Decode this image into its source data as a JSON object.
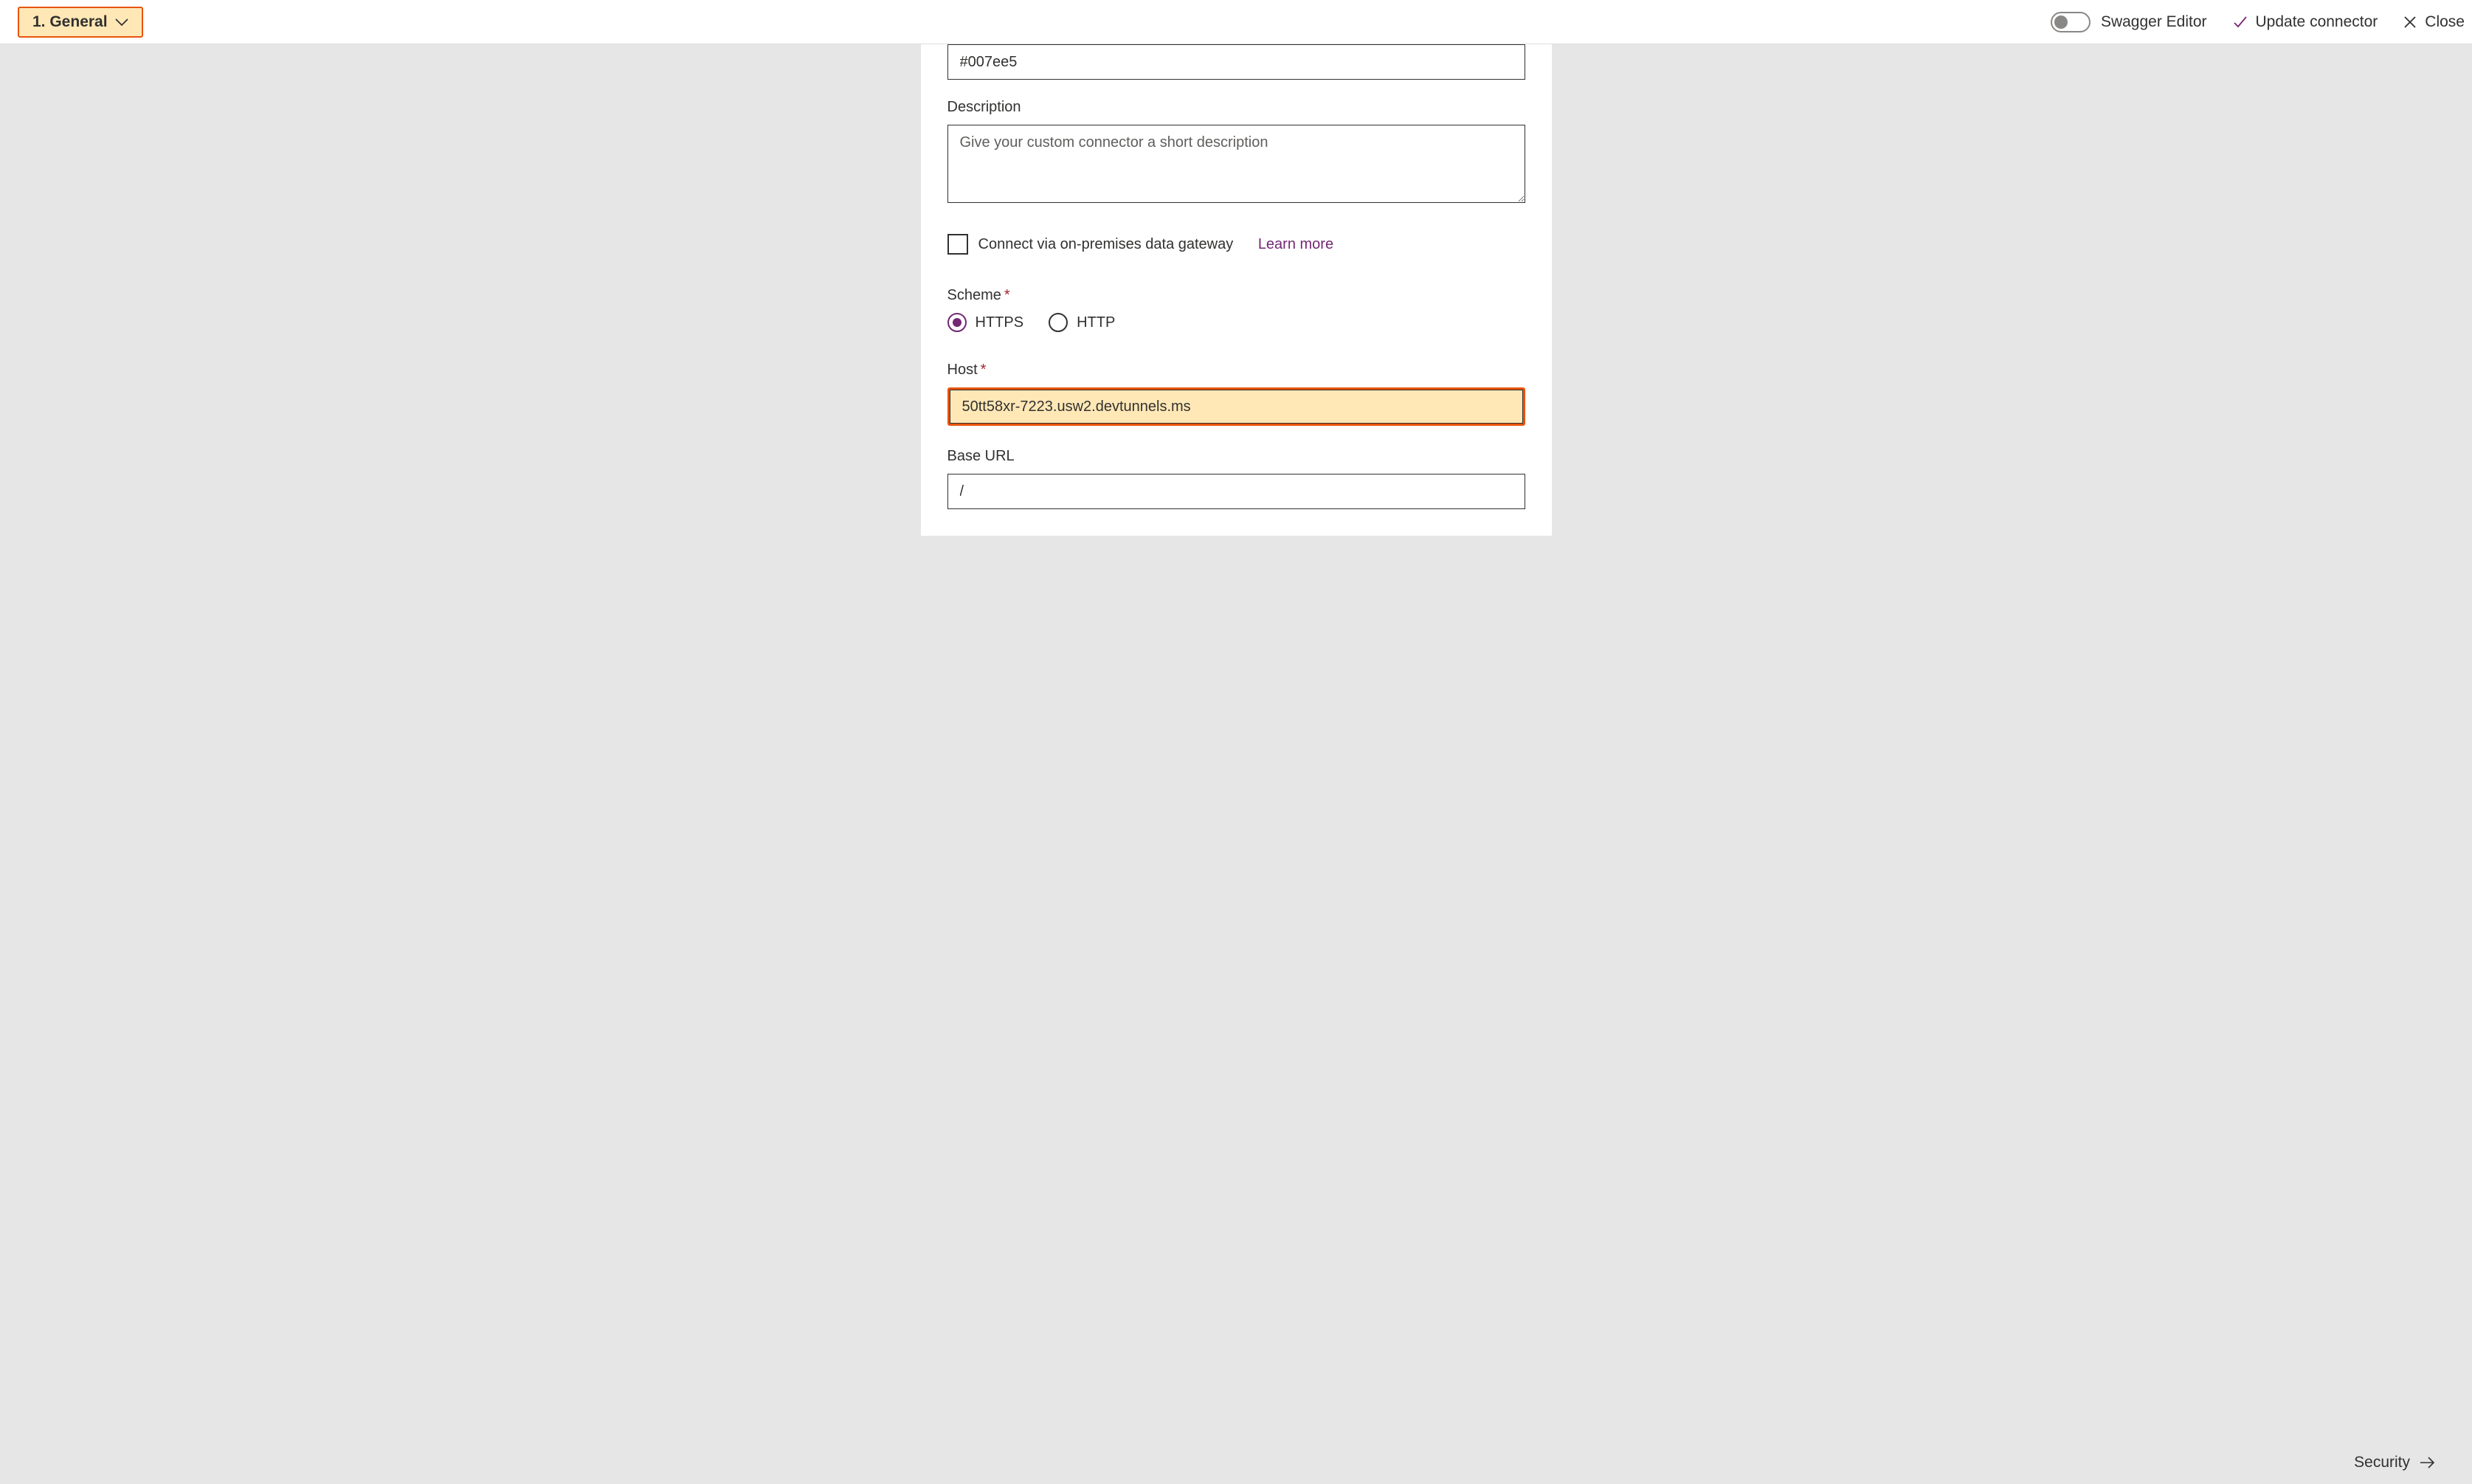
{
  "topbar": {
    "step_label": "1. General",
    "swagger_label": "Swagger Editor",
    "update_label": "Update connector",
    "close_label": "Close"
  },
  "form": {
    "color_value": "#007ee5",
    "description_label": "Description",
    "description_placeholder": "Give your custom connector a short description",
    "gateway_label": "Connect via on-premises data gateway",
    "gateway_learn": "Learn more",
    "scheme_label": "Scheme",
    "scheme_https": "HTTPS",
    "scheme_http": "HTTP",
    "scheme_selected": "HTTPS",
    "host_label": "Host",
    "host_value": "50tt58xr-7223.usw2.devtunnels.ms",
    "baseurl_label": "Base URL",
    "baseurl_value": "/"
  },
  "footer": {
    "next_label": "Security"
  }
}
